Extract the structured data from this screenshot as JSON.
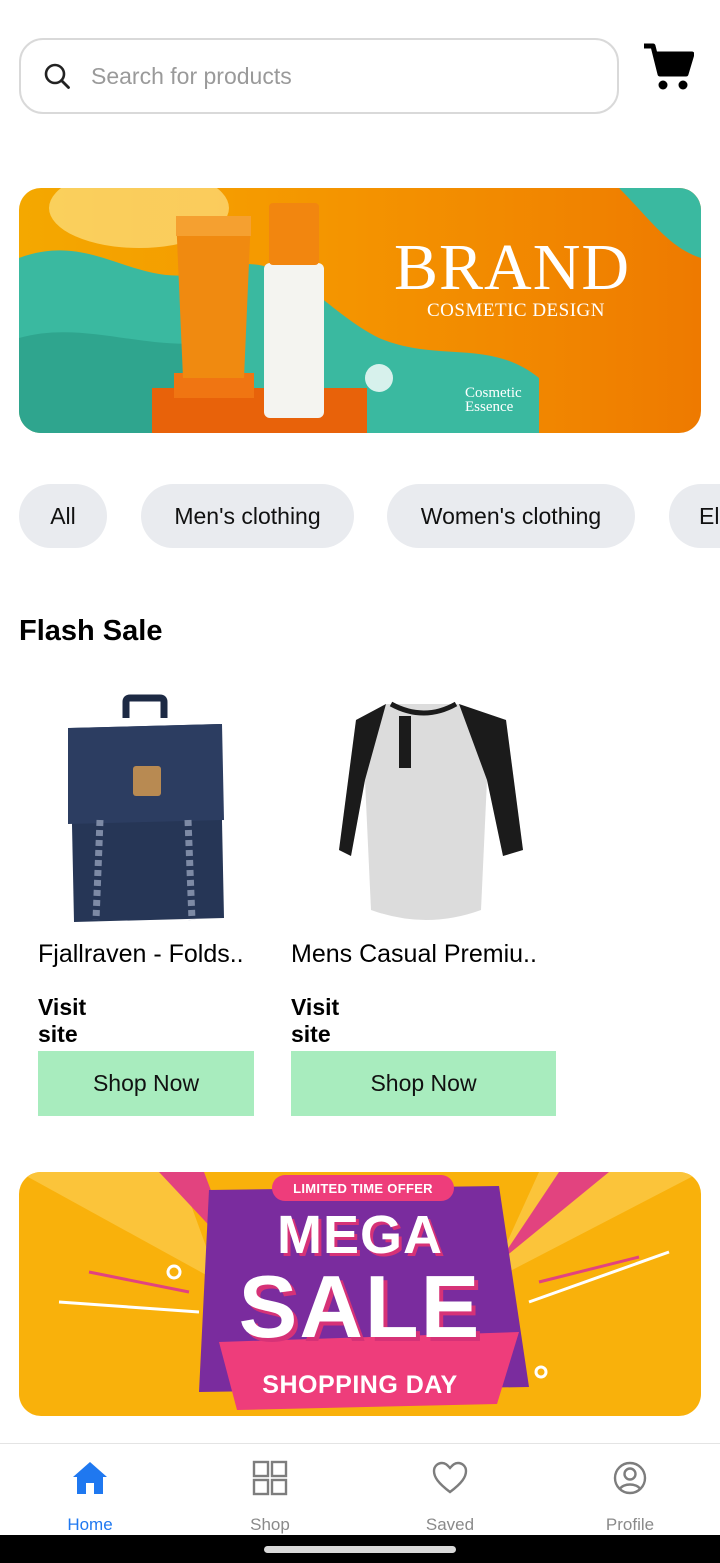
{
  "search": {
    "placeholder": "Search for products",
    "icon": "search-icon"
  },
  "header": {
    "cart_icon": "cart-icon"
  },
  "banner_top": {
    "title": "BRAND",
    "subtitle": "COSMETIC DESIGN",
    "footer": "Cosmetic Essence",
    "colors": {
      "base": "#f59a00",
      "accent": "#3ab9a0"
    }
  },
  "categories": [
    "All",
    "Men's clothing",
    "Women's clothing",
    "Electronics"
  ],
  "flash_sale": {
    "title": "Flash Sale",
    "products": [
      {
        "name": "Fjallraven - Folds..",
        "link": "Visit site",
        "button": "Shop Now",
        "image": "backpack-image"
      },
      {
        "name": "Mens Casual Premiu..",
        "link": "Visit site",
        "button": "Shop Now",
        "image": "tshirt-image"
      }
    ]
  },
  "banner_sale": {
    "tag": "LIMITED TIME OFFER",
    "line1": "MEGA",
    "line2": "SALE",
    "line3": "SHOPPING DAY",
    "colors": {
      "base": "#f9b10b",
      "purple": "#7a2c9e",
      "pink": "#ee3d7b"
    }
  },
  "bottom_nav": {
    "active": "Home",
    "active_color": "#1f78f0",
    "items": [
      {
        "label": "Home",
        "icon": "home-icon"
      },
      {
        "label": "Shop",
        "icon": "grid-icon"
      },
      {
        "label": "Saved",
        "icon": "heart-icon"
      },
      {
        "label": "Profile",
        "icon": "profile-icon"
      }
    ]
  }
}
